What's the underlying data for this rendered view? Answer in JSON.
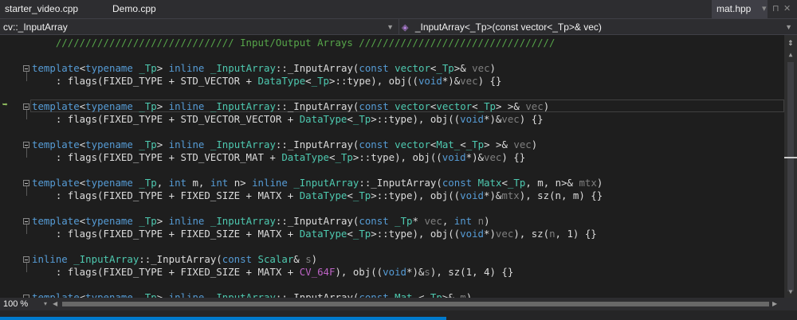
{
  "tabs": {
    "left": [
      "starter_video.cpp",
      "Demo.cpp"
    ],
    "active_right": "mat.hpp",
    "ctrl_dropdown": "▾",
    "ctrl_pin": "⊓",
    "ctrl_close": "✕"
  },
  "navbar": {
    "scope": "cv::_InputArray",
    "member": "_InputArray<_Tp>(const vector<_Tp>& vec)"
  },
  "editor": {
    "lines": [
      {
        "segs": [
          {
            "t": "    ",
            "c": ""
          },
          {
            "t": "////////////////////////////// Input/Output Arrays /////////////////////////////////",
            "c": "cm"
          }
        ]
      },
      {
        "segs": [
          {
            "t": "",
            "c": ""
          }
        ]
      },
      {
        "segs": [
          {
            "t": "template",
            "c": "kw"
          },
          {
            "t": "<",
            "c": ""
          },
          {
            "t": "typename",
            "c": "kw"
          },
          {
            "t": " ",
            "c": ""
          },
          {
            "t": "_Tp",
            "c": "ty"
          },
          {
            "t": "> ",
            "c": ""
          },
          {
            "t": "inline",
            "c": "kw"
          },
          {
            "t": " ",
            "c": ""
          },
          {
            "t": "_InputArray",
            "c": "ty"
          },
          {
            "t": "::_InputArray(",
            "c": ""
          },
          {
            "t": "const",
            "c": "kw"
          },
          {
            "t": " ",
            "c": ""
          },
          {
            "t": "vector",
            "c": "ty"
          },
          {
            "t": "<",
            "c": ""
          },
          {
            "t": "_Tp",
            "c": "ty"
          },
          {
            "t": ">& ",
            "c": ""
          },
          {
            "t": "vec",
            "c": "pr"
          },
          {
            "t": ")",
            "c": ""
          }
        ]
      },
      {
        "segs": [
          {
            "t": "    : flags(FIXED_TYPE + STD_VECTOR + ",
            "c": ""
          },
          {
            "t": "DataType",
            "c": "ty"
          },
          {
            "t": "<",
            "c": ""
          },
          {
            "t": "_Tp",
            "c": "ty"
          },
          {
            "t": ">::type), obj((",
            "c": ""
          },
          {
            "t": "void",
            "c": "kw"
          },
          {
            "t": "*)&",
            "c": ""
          },
          {
            "t": "vec",
            "c": "pr"
          },
          {
            "t": ") {}",
            "c": ""
          }
        ]
      },
      {
        "segs": [
          {
            "t": "",
            "c": ""
          }
        ]
      },
      {
        "segs": [
          {
            "t": "template",
            "c": "kw"
          },
          {
            "t": "<",
            "c": ""
          },
          {
            "t": "typename",
            "c": "kw"
          },
          {
            "t": " ",
            "c": ""
          },
          {
            "t": "_Tp",
            "c": "ty"
          },
          {
            "t": "> ",
            "c": ""
          },
          {
            "t": "inline",
            "c": "kw"
          },
          {
            "t": " ",
            "c": ""
          },
          {
            "t": "_InputArray",
            "c": "ty"
          },
          {
            "t": "::_InputArray(",
            "c": ""
          },
          {
            "t": "const",
            "c": "kw"
          },
          {
            "t": " ",
            "c": ""
          },
          {
            "t": "vector",
            "c": "ty"
          },
          {
            "t": "<",
            "c": ""
          },
          {
            "t": "vector",
            "c": "ty"
          },
          {
            "t": "<",
            "c": ""
          },
          {
            "t": "_Tp",
            "c": "ty"
          },
          {
            "t": "> >& ",
            "c": ""
          },
          {
            "t": "vec",
            "c": "pr"
          },
          {
            "t": ")",
            "c": ""
          }
        ]
      },
      {
        "segs": [
          {
            "t": "    : flags(FIXED_TYPE + STD_VECTOR_VECTOR + ",
            "c": ""
          },
          {
            "t": "DataType",
            "c": "ty"
          },
          {
            "t": "<",
            "c": ""
          },
          {
            "t": "_Tp",
            "c": "ty"
          },
          {
            "t": ">::type), obj((",
            "c": ""
          },
          {
            "t": "void",
            "c": "kw"
          },
          {
            "t": "*)&",
            "c": ""
          },
          {
            "t": "vec",
            "c": "pr"
          },
          {
            "t": ") {}",
            "c": ""
          }
        ]
      },
      {
        "segs": [
          {
            "t": "",
            "c": ""
          }
        ]
      },
      {
        "segs": [
          {
            "t": "template",
            "c": "kw"
          },
          {
            "t": "<",
            "c": ""
          },
          {
            "t": "typename",
            "c": "kw"
          },
          {
            "t": " ",
            "c": ""
          },
          {
            "t": "_Tp",
            "c": "ty"
          },
          {
            "t": "> ",
            "c": ""
          },
          {
            "t": "inline",
            "c": "kw"
          },
          {
            "t": " ",
            "c": ""
          },
          {
            "t": "_InputArray",
            "c": "ty"
          },
          {
            "t": "::_InputArray(",
            "c": ""
          },
          {
            "t": "const",
            "c": "kw"
          },
          {
            "t": " ",
            "c": ""
          },
          {
            "t": "vector",
            "c": "ty"
          },
          {
            "t": "<",
            "c": ""
          },
          {
            "t": "Mat_",
            "c": "ty"
          },
          {
            "t": "<",
            "c": ""
          },
          {
            "t": "_Tp",
            "c": "ty"
          },
          {
            "t": "> >& ",
            "c": ""
          },
          {
            "t": "vec",
            "c": "pr"
          },
          {
            "t": ")",
            "c": ""
          }
        ]
      },
      {
        "segs": [
          {
            "t": "    : flags(FIXED_TYPE + STD_VECTOR_MAT + ",
            "c": ""
          },
          {
            "t": "DataType",
            "c": "ty"
          },
          {
            "t": "<",
            "c": ""
          },
          {
            "t": "_Tp",
            "c": "ty"
          },
          {
            "t": ">::type), obj((",
            "c": ""
          },
          {
            "t": "void",
            "c": "kw"
          },
          {
            "t": "*)&",
            "c": ""
          },
          {
            "t": "vec",
            "c": "pr"
          },
          {
            "t": ") {}",
            "c": ""
          }
        ]
      },
      {
        "segs": [
          {
            "t": "",
            "c": ""
          }
        ]
      },
      {
        "segs": [
          {
            "t": "template",
            "c": "kw"
          },
          {
            "t": "<",
            "c": ""
          },
          {
            "t": "typename",
            "c": "kw"
          },
          {
            "t": " ",
            "c": ""
          },
          {
            "t": "_Tp",
            "c": "ty"
          },
          {
            "t": ", ",
            "c": ""
          },
          {
            "t": "int",
            "c": "kw"
          },
          {
            "t": " m, ",
            "c": ""
          },
          {
            "t": "int",
            "c": "kw"
          },
          {
            "t": " n> ",
            "c": ""
          },
          {
            "t": "inline",
            "c": "kw"
          },
          {
            "t": " ",
            "c": ""
          },
          {
            "t": "_InputArray",
            "c": "ty"
          },
          {
            "t": "::_InputArray(",
            "c": ""
          },
          {
            "t": "const",
            "c": "kw"
          },
          {
            "t": " ",
            "c": ""
          },
          {
            "t": "Matx",
            "c": "ty"
          },
          {
            "t": "<",
            "c": ""
          },
          {
            "t": "_Tp",
            "c": "ty"
          },
          {
            "t": ", m, n>& ",
            "c": ""
          },
          {
            "t": "mtx",
            "c": "pr"
          },
          {
            "t": ")",
            "c": ""
          }
        ]
      },
      {
        "segs": [
          {
            "t": "    : flags(FIXED_TYPE + FIXED_SIZE + MATX + ",
            "c": ""
          },
          {
            "t": "DataType",
            "c": "ty"
          },
          {
            "t": "<",
            "c": ""
          },
          {
            "t": "_Tp",
            "c": "ty"
          },
          {
            "t": ">::type), obj((",
            "c": ""
          },
          {
            "t": "void",
            "c": "kw"
          },
          {
            "t": "*)&",
            "c": ""
          },
          {
            "t": "mtx",
            "c": "pr"
          },
          {
            "t": "), sz(n, m) {}",
            "c": ""
          }
        ]
      },
      {
        "segs": [
          {
            "t": "",
            "c": ""
          }
        ]
      },
      {
        "segs": [
          {
            "t": "template",
            "c": "kw"
          },
          {
            "t": "<",
            "c": ""
          },
          {
            "t": "typename",
            "c": "kw"
          },
          {
            "t": " ",
            "c": ""
          },
          {
            "t": "_Tp",
            "c": "ty"
          },
          {
            "t": "> ",
            "c": ""
          },
          {
            "t": "inline",
            "c": "kw"
          },
          {
            "t": " ",
            "c": ""
          },
          {
            "t": "_InputArray",
            "c": "ty"
          },
          {
            "t": "::_InputArray(",
            "c": ""
          },
          {
            "t": "const",
            "c": "kw"
          },
          {
            "t": " ",
            "c": ""
          },
          {
            "t": "_Tp",
            "c": "ty"
          },
          {
            "t": "* ",
            "c": ""
          },
          {
            "t": "vec",
            "c": "pr"
          },
          {
            "t": ", ",
            "c": ""
          },
          {
            "t": "int",
            "c": "kw"
          },
          {
            "t": " ",
            "c": ""
          },
          {
            "t": "n",
            "c": "pr"
          },
          {
            "t": ")",
            "c": ""
          }
        ]
      },
      {
        "segs": [
          {
            "t": "    : flags(FIXED_TYPE + FIXED_SIZE + MATX + ",
            "c": ""
          },
          {
            "t": "DataType",
            "c": "ty"
          },
          {
            "t": "<",
            "c": ""
          },
          {
            "t": "_Tp",
            "c": "ty"
          },
          {
            "t": ">::type), obj((",
            "c": ""
          },
          {
            "t": "void",
            "c": "kw"
          },
          {
            "t": "*)",
            "c": ""
          },
          {
            "t": "vec",
            "c": "pr"
          },
          {
            "t": "), sz(",
            "c": ""
          },
          {
            "t": "n",
            "c": "pr"
          },
          {
            "t": ", 1) {}",
            "c": ""
          }
        ]
      },
      {
        "segs": [
          {
            "t": "",
            "c": ""
          }
        ]
      },
      {
        "segs": [
          {
            "t": "inline",
            "c": "kw"
          },
          {
            "t": " ",
            "c": ""
          },
          {
            "t": "_InputArray",
            "c": "ty"
          },
          {
            "t": "::_InputArray(",
            "c": ""
          },
          {
            "t": "const",
            "c": "kw"
          },
          {
            "t": " ",
            "c": ""
          },
          {
            "t": "Scalar",
            "c": "ty"
          },
          {
            "t": "& ",
            "c": ""
          },
          {
            "t": "s",
            "c": "pr"
          },
          {
            "t": ")",
            "c": ""
          }
        ]
      },
      {
        "segs": [
          {
            "t": "    : flags(FIXED_TYPE + FIXED_SIZE + MATX + ",
            "c": ""
          },
          {
            "t": "CV_64F",
            "c": "mc"
          },
          {
            "t": "), obj((",
            "c": ""
          },
          {
            "t": "void",
            "c": "kw"
          },
          {
            "t": "*)&",
            "c": ""
          },
          {
            "t": "s",
            "c": "pr"
          },
          {
            "t": "), sz(1, 4) {}",
            "c": ""
          }
        ]
      },
      {
        "segs": [
          {
            "t": "",
            "c": ""
          }
        ]
      },
      {
        "segs": [
          {
            "t": "template",
            "c": "kw"
          },
          {
            "t": "<",
            "c": ""
          },
          {
            "t": "typename",
            "c": "kw"
          },
          {
            "t": " ",
            "c": ""
          },
          {
            "t": "_Tp",
            "c": "ty"
          },
          {
            "t": "> ",
            "c": ""
          },
          {
            "t": "inline",
            "c": "kw"
          },
          {
            "t": " ",
            "c": ""
          },
          {
            "t": "_InputArray",
            "c": "ty"
          },
          {
            "t": "::_InputArray(",
            "c": ""
          },
          {
            "t": "const",
            "c": "kw"
          },
          {
            "t": " ",
            "c": ""
          },
          {
            "t": "Mat_",
            "c": "ty"
          },
          {
            "t": "<",
            "c": ""
          },
          {
            "t": "_Tp",
            "c": "ty"
          },
          {
            "t": ">& ",
            "c": ""
          },
          {
            "t": "m",
            "c": "pr"
          },
          {
            "t": ")",
            "c": ""
          }
        ]
      }
    ],
    "fold_lines": [
      2,
      5,
      8,
      11,
      14,
      17,
      20
    ],
    "current_line": 3,
    "current_line_marker": "➥"
  },
  "scrollbar": {
    "split": "⇕",
    "up": "▲",
    "down": "▼",
    "left": "◀",
    "right": "▶"
  },
  "statusbar": {
    "zoom": "100 %",
    "zoom_arrow": "▾"
  },
  "colors": {
    "comment": "#57a64a",
    "keyword": "#569cd6",
    "type": "#4ec9b0",
    "param": "#7f7f7f",
    "macro": "#bd63c5",
    "accent": "#007acc"
  }
}
